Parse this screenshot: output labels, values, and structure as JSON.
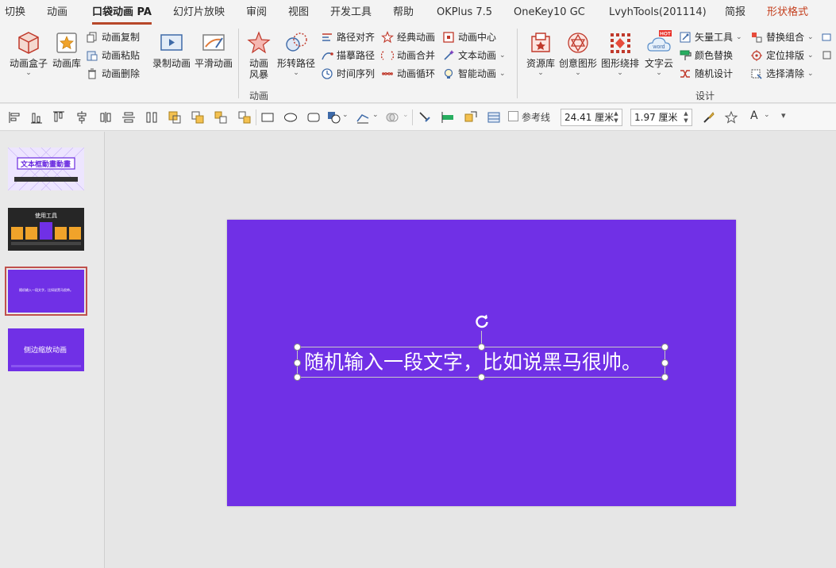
{
  "tabs": [
    "切换",
    "动画",
    "口袋动画 PA",
    "幻灯片放映",
    "审阅",
    "视图",
    "开发工具",
    "帮助",
    "OKPlus 7.5",
    "OneKey10 GC",
    "LvyhTools(201114)",
    "简报",
    "形状格式"
  ],
  "active_tab": "口袋动画 PA",
  "ribbon": {
    "animation_group": {
      "label": "动画",
      "box": "动画盒子",
      "library": "动画库",
      "copy": "动画复制",
      "paste": "动画粘贴",
      "delete": "动画删除",
      "record": "录制动画",
      "smooth": "平滑动画",
      "storm_line1": "动画",
      "storm_line2": "风暴",
      "shape_path": "形转路径",
      "path_align": "路径对齐",
      "trace_path": "描摹路径",
      "time_sequence": "时间序列",
      "classic": "经典动画",
      "merge": "动画合并",
      "loop": "动画循环",
      "center": "动画中心",
      "text_anim": "文本动画",
      "smart_anim": "智能动画"
    },
    "design_group": {
      "label": "设计",
      "resource": "资源库",
      "creative": "创意图形",
      "arrange": "图形绕排",
      "wordcloud": "文字云",
      "hot_badge": "HOT",
      "word_text": "word",
      "vector_tools": "矢量工具",
      "color_replace": "颜色替换",
      "random_design": "随机设计",
      "replace_combo": "替换组合",
      "position_layout": "定位排版",
      "select_clear": "选择清除"
    }
  },
  "quickbar": {
    "guides_label": "参考线",
    "width_value": "24.41 厘米",
    "height_value": "1.97 厘米",
    "font_label": "A"
  },
  "thumbnails": [
    {
      "title": "文本框動畫動畫",
      "subtitle": "",
      "bg": "#e8e0ff"
    },
    {
      "title": "使用工具",
      "bg": "#222222"
    },
    {
      "title": "随机输入一段文字，比如说黑马很帅。",
      "bg": "#7030e6"
    },
    {
      "title": "侧边缩放动画",
      "bg": "#7030e6"
    }
  ],
  "slide": {
    "text": "随机输入一段文字，比如说黑马很帅。",
    "background": "#7030e6"
  },
  "colors": {
    "accent": "#b7472a",
    "shape_format": "#c43e1c",
    "slide_purple": "#7030e6",
    "hot_red": "#e8312a"
  }
}
